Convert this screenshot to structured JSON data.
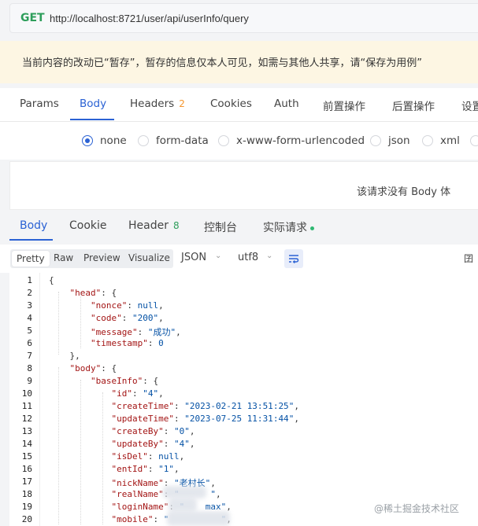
{
  "request": {
    "method": "GET",
    "url": "http://localhost:8721/user/api/userInfo/query"
  },
  "notice": "当前内容的改动已“暂存”，暂存的信息仅本人可见，如需与其他人共享，请“保存为用例”",
  "request_tabs": {
    "params": "Params",
    "body": "Body",
    "headers": "Headers",
    "headers_count": "2",
    "cookies": "Cookies",
    "auth": "Auth",
    "pre": "前置操作",
    "post": "后置操作",
    "settings": "设置"
  },
  "body_types": {
    "none": "none",
    "form_data": "form-data",
    "urlencoded": "x-www-form-urlencoded",
    "json": "json",
    "xml": "xml"
  },
  "no_body_text": "该请求没有 Body 体",
  "response_tabs": {
    "body": "Body",
    "cookie": "Cookie",
    "header": "Header",
    "header_count": "8",
    "console": "控制台",
    "actual": "实际请求"
  },
  "toolbar": {
    "pretty": "Pretty",
    "raw": "Raw",
    "preview": "Preview",
    "visualize": "Visualize",
    "format": "JSON",
    "encoding": "utf8",
    "right_icon": "囝"
  },
  "code_lines": [
    {
      "n": "1",
      "t": "{"
    },
    {
      "n": "2",
      "t": "    \"head\": {"
    },
    {
      "n": "3",
      "t": "        \"nonce\": null,"
    },
    {
      "n": "4",
      "t": "        \"code\": \"200\","
    },
    {
      "n": "5",
      "t": "        \"message\": \"成功\","
    },
    {
      "n": "6",
      "t": "        \"timestamp\": 0"
    },
    {
      "n": "7",
      "t": "    },"
    },
    {
      "n": "8",
      "t": "    \"body\": {"
    },
    {
      "n": "9",
      "t": "        \"baseInfo\": {"
    },
    {
      "n": "10",
      "t": "            \"id\": \"4\","
    },
    {
      "n": "11",
      "t": "            \"createTime\": \"2023-02-21 13:51:25\","
    },
    {
      "n": "12",
      "t": "            \"updateTime\": \"2023-07-25 11:31:44\","
    },
    {
      "n": "13",
      "t": "            \"createBy\": \"0\","
    },
    {
      "n": "14",
      "t": "            \"updateBy\": \"4\","
    },
    {
      "n": "15",
      "t": "            \"isDel\": null,"
    },
    {
      "n": "16",
      "t": "            \"entId\": \"1\","
    },
    {
      "n": "17",
      "t": "            \"nickName\": \"老村长\","
    },
    {
      "n": "18",
      "t": "            \"realName\": \"      \","
    },
    {
      "n": "19",
      "t": "            \"loginName\": \"    max\","
    },
    {
      "n": "20",
      "t": "            \"mobile\": \"          \","
    }
  ],
  "watermark": "@稀土掘金技术社区"
}
